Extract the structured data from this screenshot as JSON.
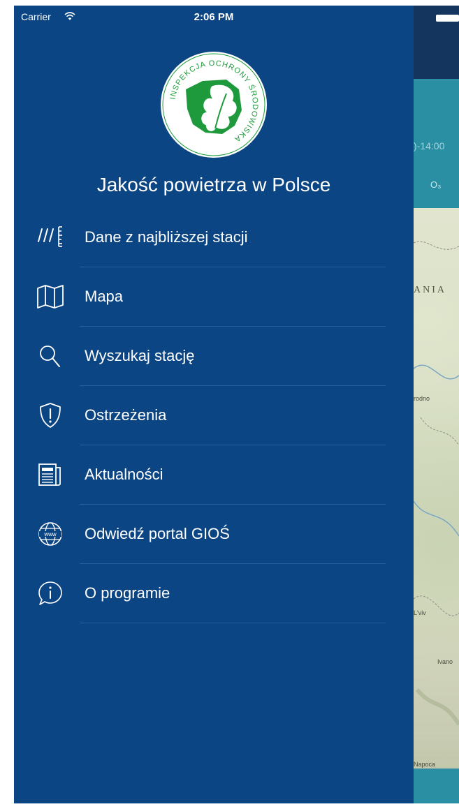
{
  "status_bar": {
    "carrier": "Carrier",
    "time": "2:06 PM"
  },
  "logo": {
    "ring_text": "INSPEKCJA OCHRONY ŚRODOWISKA",
    "color": "#1e9a3c"
  },
  "drawer": {
    "title": "Jakość powietrza w Polsce",
    "items": [
      {
        "label": "Dane z najbliższej stacji",
        "icon": "station-data-icon"
      },
      {
        "label": "Mapa",
        "icon": "map-icon"
      },
      {
        "label": "Wyszukaj stację",
        "icon": "search-icon"
      },
      {
        "label": "Ostrzeżenia",
        "icon": "warning-shield-icon"
      },
      {
        "label": "Aktualności",
        "icon": "news-icon"
      },
      {
        "label": "Odwiedź portal GIOŚ",
        "icon": "globe-www-icon"
      },
      {
        "label": "O programie",
        "icon": "info-icon"
      }
    ]
  },
  "background_view": {
    "time_fragment": ")-14:00",
    "pollutant_tab": "O₃",
    "map_labels": [
      "ANIA",
      "rodno",
      "L'viv",
      "Ivano",
      "Napoca"
    ]
  },
  "colors": {
    "drawer_bg": "#0c4583",
    "header_bg": "#14355e",
    "teal": "#2b8fa4",
    "separator": "#2b5f99"
  }
}
